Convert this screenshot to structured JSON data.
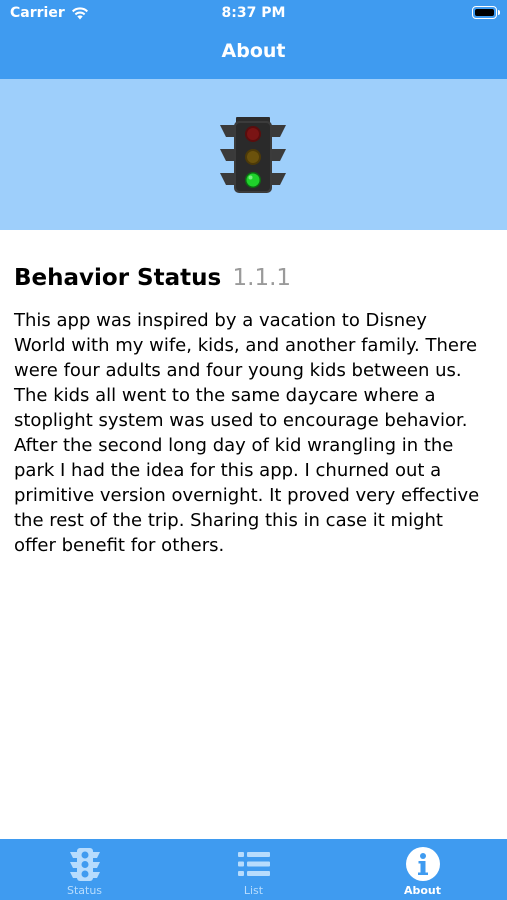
{
  "status_bar": {
    "carrier": "Carrier",
    "time": "8:37 PM"
  },
  "nav": {
    "title": "About"
  },
  "about": {
    "app_name": "Behavior Status",
    "version": "1.1.1",
    "description": "This app was inspired by a vacation to Disney\nWorld with my wife, kids, and another family. There\nwere four adults and four young kids between us.\nThe kids all went to the same daycare where a\nstoplight system was used to encourage behavior.\nAfter the second long day of kid wrangling in the\npark I had the idea for this app. I churned out a\nprimitive version overnight. It proved very effective\nthe rest of the trip.  Sharing this in case it might\noffer benefit for others."
  },
  "tabs": [
    {
      "label": "Status",
      "icon": "traffic-light-icon",
      "active": false
    },
    {
      "label": "List",
      "icon": "list-icon",
      "active": false
    },
    {
      "label": "About",
      "icon": "info-icon",
      "active": true
    }
  ],
  "colors": {
    "bar_blue": "#3f9bf0",
    "banner_blue": "#9ecffb",
    "inactive_tab": "#b7dcfd",
    "version_gray": "#9a9a9a"
  }
}
